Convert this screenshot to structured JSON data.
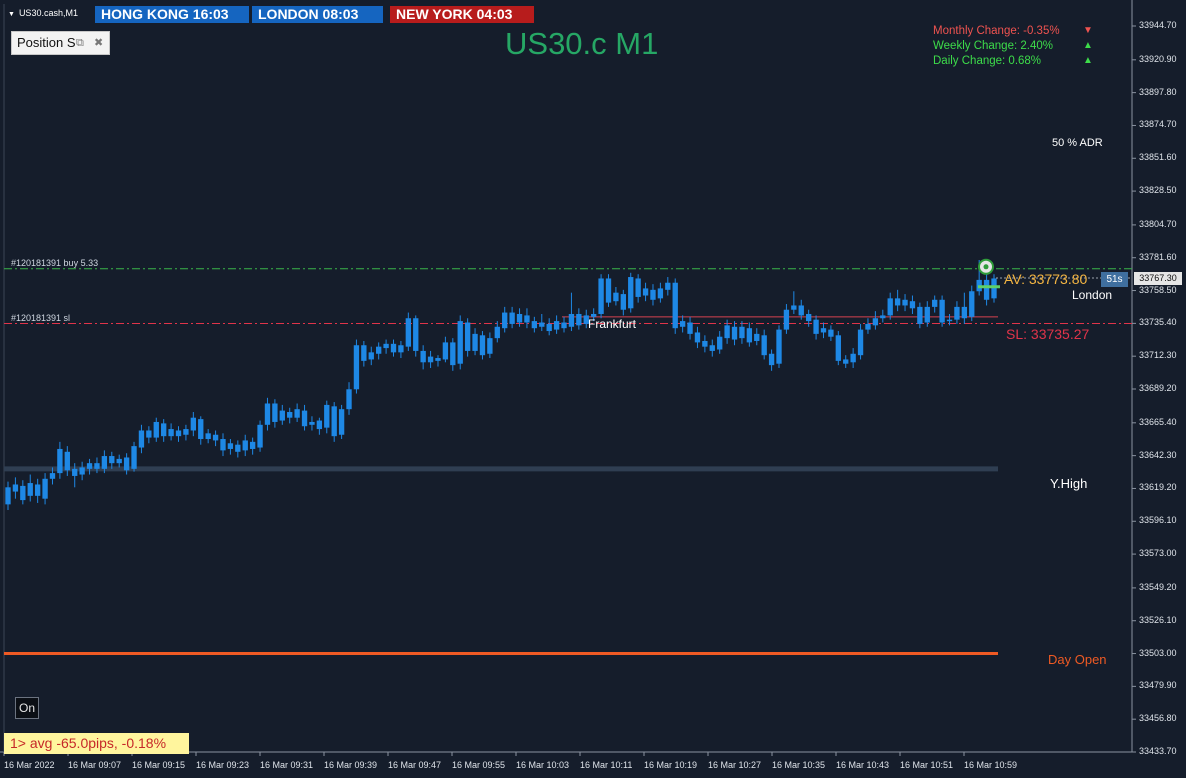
{
  "symbol_label": "US30.cash,M1",
  "clocks": [
    {
      "label": "HONG KONG  16:03",
      "color": "#1565c0"
    },
    {
      "label": "LONDON  08:03",
      "color": "#1565c0"
    },
    {
      "label": "NEW YORK  04:03",
      "color": "#b71c1c"
    }
  ],
  "position_panel": {
    "label": "Position S",
    "restore_icon": "restore-icon",
    "close_icon": "close-icon"
  },
  "title": "US30.c M1",
  "changes": [
    {
      "label": "Monthly Change: -0.35%",
      "direction": "down",
      "color": "#ef5350"
    },
    {
      "label": "Weekly Change: 2.40%",
      "direction": "up",
      "color": "#3ddc4a"
    },
    {
      "label": "Daily Change: 0.68%",
      "direction": "up",
      "color": "#3ddc4a"
    }
  ],
  "adr_label": "50 % ADR",
  "orders": {
    "buy_label": "#120181391 buy 5.33",
    "sl_label": "#120181391 sl"
  },
  "session_labels": {
    "frankfurt": "Frankfurt",
    "london": "London"
  },
  "av_label": "AV: 33773.80",
  "sl_label": "SL: 33735.27",
  "yhigh_label": "Y.High",
  "day_open_label": "Day Open",
  "bar_timer": "51s",
  "current_price": "33767.30",
  "on_button": "On",
  "avg_box": "1> avg -65.0pips, -0.18%",
  "colors": {
    "background": "#151d2b",
    "candle": "#1e88e5",
    "buy_line": "#39b54a",
    "sl_line": "#e0344a",
    "yhigh_line": "#2f3e52",
    "day_open_line": "#ee5a24",
    "av_text": "#f5b642"
  },
  "chart_data": {
    "type": "candlestick",
    "symbol": "US30.c",
    "timeframe": "M1",
    "ylim": [
      33433.7,
      33955
    ],
    "price_ticks": [
      "33944.70",
      "33920.90",
      "33897.80",
      "33874.70",
      "33851.60",
      "33828.50",
      "33804.70",
      "33781.60",
      "33758.50",
      "33735.40",
      "33712.30",
      "33689.20",
      "33665.40",
      "33642.30",
      "33619.20",
      "33596.10",
      "33573.00",
      "33549.20",
      "33526.10",
      "33503.00",
      "33479.90",
      "33456.80",
      "33433.70"
    ],
    "time_ticks": [
      "16 Mar 2022",
      "16 Mar 09:07",
      "16 Mar 09:15",
      "16 Mar 09:23",
      "16 Mar 09:31",
      "16 Mar 09:39",
      "16 Mar 09:47",
      "16 Mar 09:55",
      "16 Mar 10:03",
      "16 Mar 10:11",
      "16 Mar 10:19",
      "16 Mar 10:27",
      "16 Mar 10:35",
      "16 Mar 10:43",
      "16 Mar 10:51",
      "16 Mar 10:59"
    ],
    "levels": {
      "buy_entry": 33773.8,
      "stop_loss": 33735.27,
      "y_high": 33633.0,
      "day_open": 33503.0,
      "session_line": 33740.0
    },
    "candles": [
      [
        33620,
        33608,
        33624,
        33604
      ],
      [
        33617,
        33622,
        33627,
        33612
      ],
      [
        33621,
        33611,
        33625,
        33608
      ],
      [
        33614,
        33623,
        33629,
        33610
      ],
      [
        33622,
        33614,
        33626,
        33609
      ],
      [
        33612,
        33626,
        33630,
        33608
      ],
      [
        33626,
        33630,
        33634,
        33622
      ],
      [
        33630,
        33647,
        33652,
        33626
      ],
      [
        33645,
        33632,
        33649,
        33628
      ],
      [
        33633,
        33628,
        33637,
        33620
      ],
      [
        33629,
        33634,
        33638,
        33625
      ],
      [
        33633,
        33637,
        33640,
        33629
      ],
      [
        33637,
        33633,
        33641,
        33630
      ],
      [
        33633,
        33642,
        33646,
        33630
      ],
      [
        33642,
        33637,
        33645,
        33633
      ],
      [
        33637,
        33640,
        33643,
        33634
      ],
      [
        33641,
        33632,
        33644,
        33629
      ],
      [
        33633,
        33649,
        33652,
        33631
      ],
      [
        33648,
        33660,
        33664,
        33644
      ],
      [
        33660,
        33655,
        33663,
        33651
      ],
      [
        33655,
        33666,
        33669,
        33652
      ],
      [
        33665,
        33656,
        33668,
        33652
      ],
      [
        33656,
        33661,
        33665,
        33653
      ],
      [
        33660,
        33656,
        33663,
        33652
      ],
      [
        33657,
        33661,
        33664,
        33653
      ],
      [
        33660,
        33669,
        33673,
        33656
      ],
      [
        33668,
        33654,
        33670,
        33650
      ],
      [
        33654,
        33658,
        33661,
        33651
      ],
      [
        33657,
        33653,
        33660,
        33649
      ],
      [
        33654,
        33646,
        33658,
        33642
      ],
      [
        33647,
        33651,
        33654,
        33643
      ],
      [
        33650,
        33645,
        33653,
        33641
      ],
      [
        33646,
        33653,
        33657,
        33642
      ],
      [
        33652,
        33647,
        33655,
        33643
      ],
      [
        33648,
        33664,
        33667,
        33645
      ],
      [
        33664,
        33679,
        33683,
        33660
      ],
      [
        33679,
        33666,
        33682,
        33662
      ],
      [
        33667,
        33674,
        33678,
        33664
      ],
      [
        33673,
        33669,
        33676,
        33665
      ],
      [
        33669,
        33675,
        33679,
        33666
      ],
      [
        33674,
        33663,
        33678,
        33660
      ],
      [
        33664,
        33666,
        33670,
        33660
      ],
      [
        33667,
        33661,
        33669,
        33657
      ],
      [
        33662,
        33678,
        33681,
        33658
      ],
      [
        33677,
        33656,
        33680,
        33652
      ],
      [
        33657,
        33675,
        33678,
        33654
      ],
      [
        33675,
        33689,
        33694,
        33671
      ],
      [
        33689,
        33720,
        33724,
        33686
      ],
      [
        33720,
        33709,
        33723,
        33705
      ],
      [
        33710,
        33715,
        33719,
        33706
      ],
      [
        33714,
        33719,
        33722,
        33710
      ],
      [
        33718,
        33721,
        33724,
        33714
      ],
      [
        33721,
        33715,
        33724,
        33712
      ],
      [
        33715,
        33720,
        33723,
        33711
      ],
      [
        33719,
        33739,
        33743,
        33716
      ],
      [
        33739,
        33716,
        33741,
        33712
      ],
      [
        33716,
        33708,
        33720,
        33703
      ],
      [
        33708,
        33712,
        33716,
        33704
      ],
      [
        33711,
        33709,
        33713,
        33705
      ],
      [
        33710,
        33722,
        33726,
        33708
      ],
      [
        33722,
        33706,
        33725,
        33702
      ],
      [
        33707,
        33737,
        33741,
        33703
      ],
      [
        33736,
        33716,
        33739,
        33712
      ],
      [
        33716,
        33728,
        33732,
        33713
      ],
      [
        33727,
        33713,
        33730,
        33710
      ],
      [
        33714,
        33725,
        33729,
        33711
      ],
      [
        33725,
        33733,
        33737,
        33722
      ],
      [
        33732,
        33743,
        33747,
        33729
      ],
      [
        33743,
        33735,
        33747,
        33732
      ],
      [
        33736,
        33742,
        33746,
        33733
      ],
      [
        33741,
        33736,
        33746,
        33732
      ],
      [
        33737,
        33732,
        33740,
        33729
      ],
      [
        33733,
        33736,
        33742,
        33730
      ],
      [
        33735,
        33730,
        33739,
        33727
      ],
      [
        33731,
        33737,
        33741,
        33728
      ],
      [
        33736,
        33732,
        33740,
        33729
      ],
      [
        33733,
        33742,
        33757,
        33730
      ],
      [
        33742,
        33734,
        33746,
        33731
      ],
      [
        33735,
        33741,
        33745,
        33732
      ],
      [
        33740,
        33742,
        33746,
        33737
      ],
      [
        33742,
        33767,
        33770,
        33739
      ],
      [
        33767,
        33750,
        33770,
        33747
      ],
      [
        33751,
        33757,
        33761,
        33748
      ],
      [
        33756,
        33745,
        33759,
        33741
      ],
      [
        33746,
        33768,
        33771,
        33743
      ],
      [
        33767,
        33754,
        33770,
        33750
      ],
      [
        33755,
        33760,
        33764,
        33751
      ],
      [
        33759,
        33752,
        33763,
        33748
      ],
      [
        33753,
        33760,
        33764,
        33750
      ],
      [
        33759,
        33764,
        33768,
        33755
      ],
      [
        33764,
        33732,
        33767,
        33728
      ],
      [
        33733,
        33737,
        33741,
        33729
      ],
      [
        33736,
        33728,
        33740,
        33724
      ],
      [
        33729,
        33722,
        33733,
        33718
      ],
      [
        33723,
        33719,
        33727,
        33715
      ],
      [
        33720,
        33716,
        33724,
        33712
      ],
      [
        33717,
        33726,
        33730,
        33714
      ],
      [
        33725,
        33734,
        33738,
        33721
      ],
      [
        33733,
        33724,
        33737,
        33720
      ],
      [
        33725,
        33733,
        33737,
        33721
      ],
      [
        33732,
        33722,
        33736,
        33719
      ],
      [
        33723,
        33728,
        33732,
        33720
      ],
      [
        33727,
        33713,
        33731,
        33710
      ],
      [
        33714,
        33706,
        33717,
        33702
      ],
      [
        33707,
        33731,
        33734,
        33704
      ],
      [
        33731,
        33745,
        33749,
        33728
      ],
      [
        33745,
        33748,
        33758,
        33742
      ],
      [
        33748,
        33741,
        33752,
        33738
      ],
      [
        33742,
        33737,
        33745,
        33733
      ],
      [
        33738,
        33728,
        33741,
        33724
      ],
      [
        33729,
        33732,
        33736,
        33725
      ],
      [
        33731,
        33726,
        33734,
        33723
      ],
      [
        33727,
        33709,
        33730,
        33706
      ],
      [
        33710,
        33707,
        33713,
        33704
      ],
      [
        33708,
        33714,
        33718,
        33704
      ],
      [
        33713,
        33731,
        33735,
        33710
      ],
      [
        33731,
        33735,
        33739,
        33728
      ],
      [
        33734,
        33739,
        33744,
        33731
      ],
      [
        33739,
        33741,
        33745,
        33736
      ],
      [
        33741,
        33753,
        33757,
        33738
      ],
      [
        33753,
        33748,
        33759,
        33744
      ],
      [
        33748,
        33752,
        33756,
        33744
      ],
      [
        33751,
        33746,
        33755,
        33742
      ],
      [
        33747,
        33735,
        33750,
        33732
      ],
      [
        33736,
        33747,
        33751,
        33733
      ],
      [
        33747,
        33752,
        33755,
        33743
      ],
      [
        33752,
        33736,
        33755,
        33733
      ],
      [
        33737,
        33738,
        33742,
        33734
      ],
      [
        33738,
        33747,
        33751,
        33735
      ],
      [
        33747,
        33739,
        33757,
        33735
      ],
      [
        33740,
        33758,
        33762,
        33737
      ],
      [
        33758,
        33766,
        33780,
        33755
      ],
      [
        33766,
        33752,
        33772,
        33748
      ],
      [
        33753,
        33767,
        33770,
        33750
      ]
    ]
  }
}
